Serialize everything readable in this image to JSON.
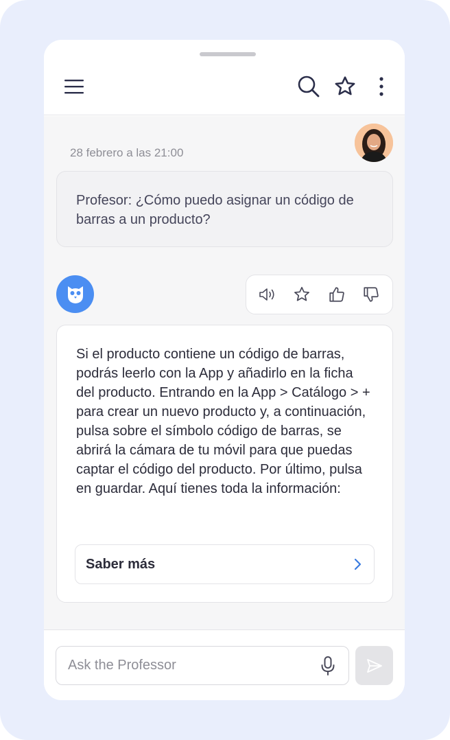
{
  "header": {
    "menu_icon": "hamburger-menu-icon",
    "search_icon": "search-icon",
    "favorite_icon": "star-icon",
    "more_icon": "vertical-dots-icon"
  },
  "chat": {
    "timestamp": "28 febrero a las 21:00",
    "user_message": "Profesor: ¿Cómo puedo asignar un código de barras a un producto?",
    "bot_message": "Si el producto contiene un código de barras, podrás leerlo con la App y añadirlo en la ficha del producto. Entrando en la App > Catálogo > + para crear un nuevo producto y, a continuación, pulsa sobre el símbolo código de barras, se abrirá la cámara de tu móvil para que puedas captar el código del producto. Por último, pulsa en guardar. Aquí tienes toda la información:",
    "learn_more_label": "Saber más",
    "actions": [
      "speaker-icon",
      "star-icon",
      "thumbs-up-icon",
      "thumbs-down-icon"
    ]
  },
  "composer": {
    "placeholder": "Ask the Professor",
    "value": "",
    "mic_icon": "microphone-icon",
    "send_icon": "send-icon"
  },
  "colors": {
    "background": "#e9eefc",
    "accent": "#4b8ef2",
    "chat_background": "#f6f6f7",
    "link_chevron": "#3a7be0"
  }
}
